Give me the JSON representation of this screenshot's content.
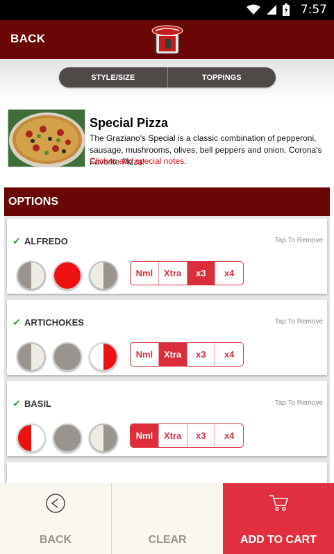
{
  "status_bar": {
    "time": "7:57"
  },
  "header": {
    "back_label": "BACK"
  },
  "tabs": [
    {
      "label": "STYLE/SIZE"
    },
    {
      "label": "TOPPINGS"
    }
  ],
  "product": {
    "title": "Special Pizza",
    "description": "The Graziano's Special is a classic combination of pepperoni, sausage, mushrooms, olives, bell peppers and onion. Corona's Favorite Pizza!",
    "notes_link": "Click to add special notes."
  },
  "options": {
    "header": "OPTIONS",
    "items": [
      {
        "name": "ALFREDO",
        "tap_label": "Tap To Remove",
        "placement": "whole",
        "quantities": [
          "Nml",
          "Xtra",
          "x3",
          "x4"
        ],
        "selected_quantity": "x3"
      },
      {
        "name": "ARTICHOKES",
        "tap_label": "Tap To Remove",
        "placement": "right",
        "quantities": [
          "Nml",
          "Xtra",
          "x3",
          "x4"
        ],
        "selected_quantity": "Xtra"
      },
      {
        "name": "BASIL",
        "tap_label": "Tap To Remove",
        "placement": "left",
        "quantities": [
          "Nml",
          "Xtra",
          "x3",
          "x4"
        ],
        "selected_quantity": "Nml"
      }
    ]
  },
  "bottom_bar": {
    "back_label": "BACK",
    "clear_label": "CLEAR",
    "cart_label": "ADD TO CART"
  },
  "colors": {
    "header": "#6b0606",
    "accent": "#dc2d3b",
    "check": "#3aa13a"
  }
}
